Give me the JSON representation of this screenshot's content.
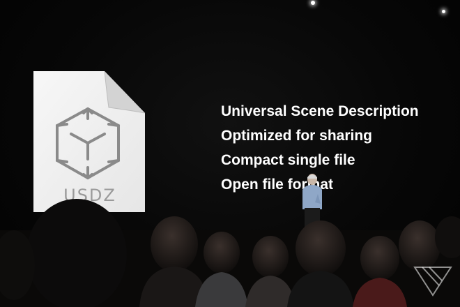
{
  "scene": {
    "background_color": "#050505",
    "text_color": "#ffffff",
    "icon_color": "#8a8a8a"
  },
  "file_icon": {
    "icon": "usdz-cube-file-icon",
    "label": "USDZ"
  },
  "slide": {
    "features": [
      "Universal Scene Description",
      "Optimized for sharing",
      "Compact single file",
      "Open file format"
    ]
  },
  "watermark": {
    "icon": "triangle-logo-icon"
  }
}
